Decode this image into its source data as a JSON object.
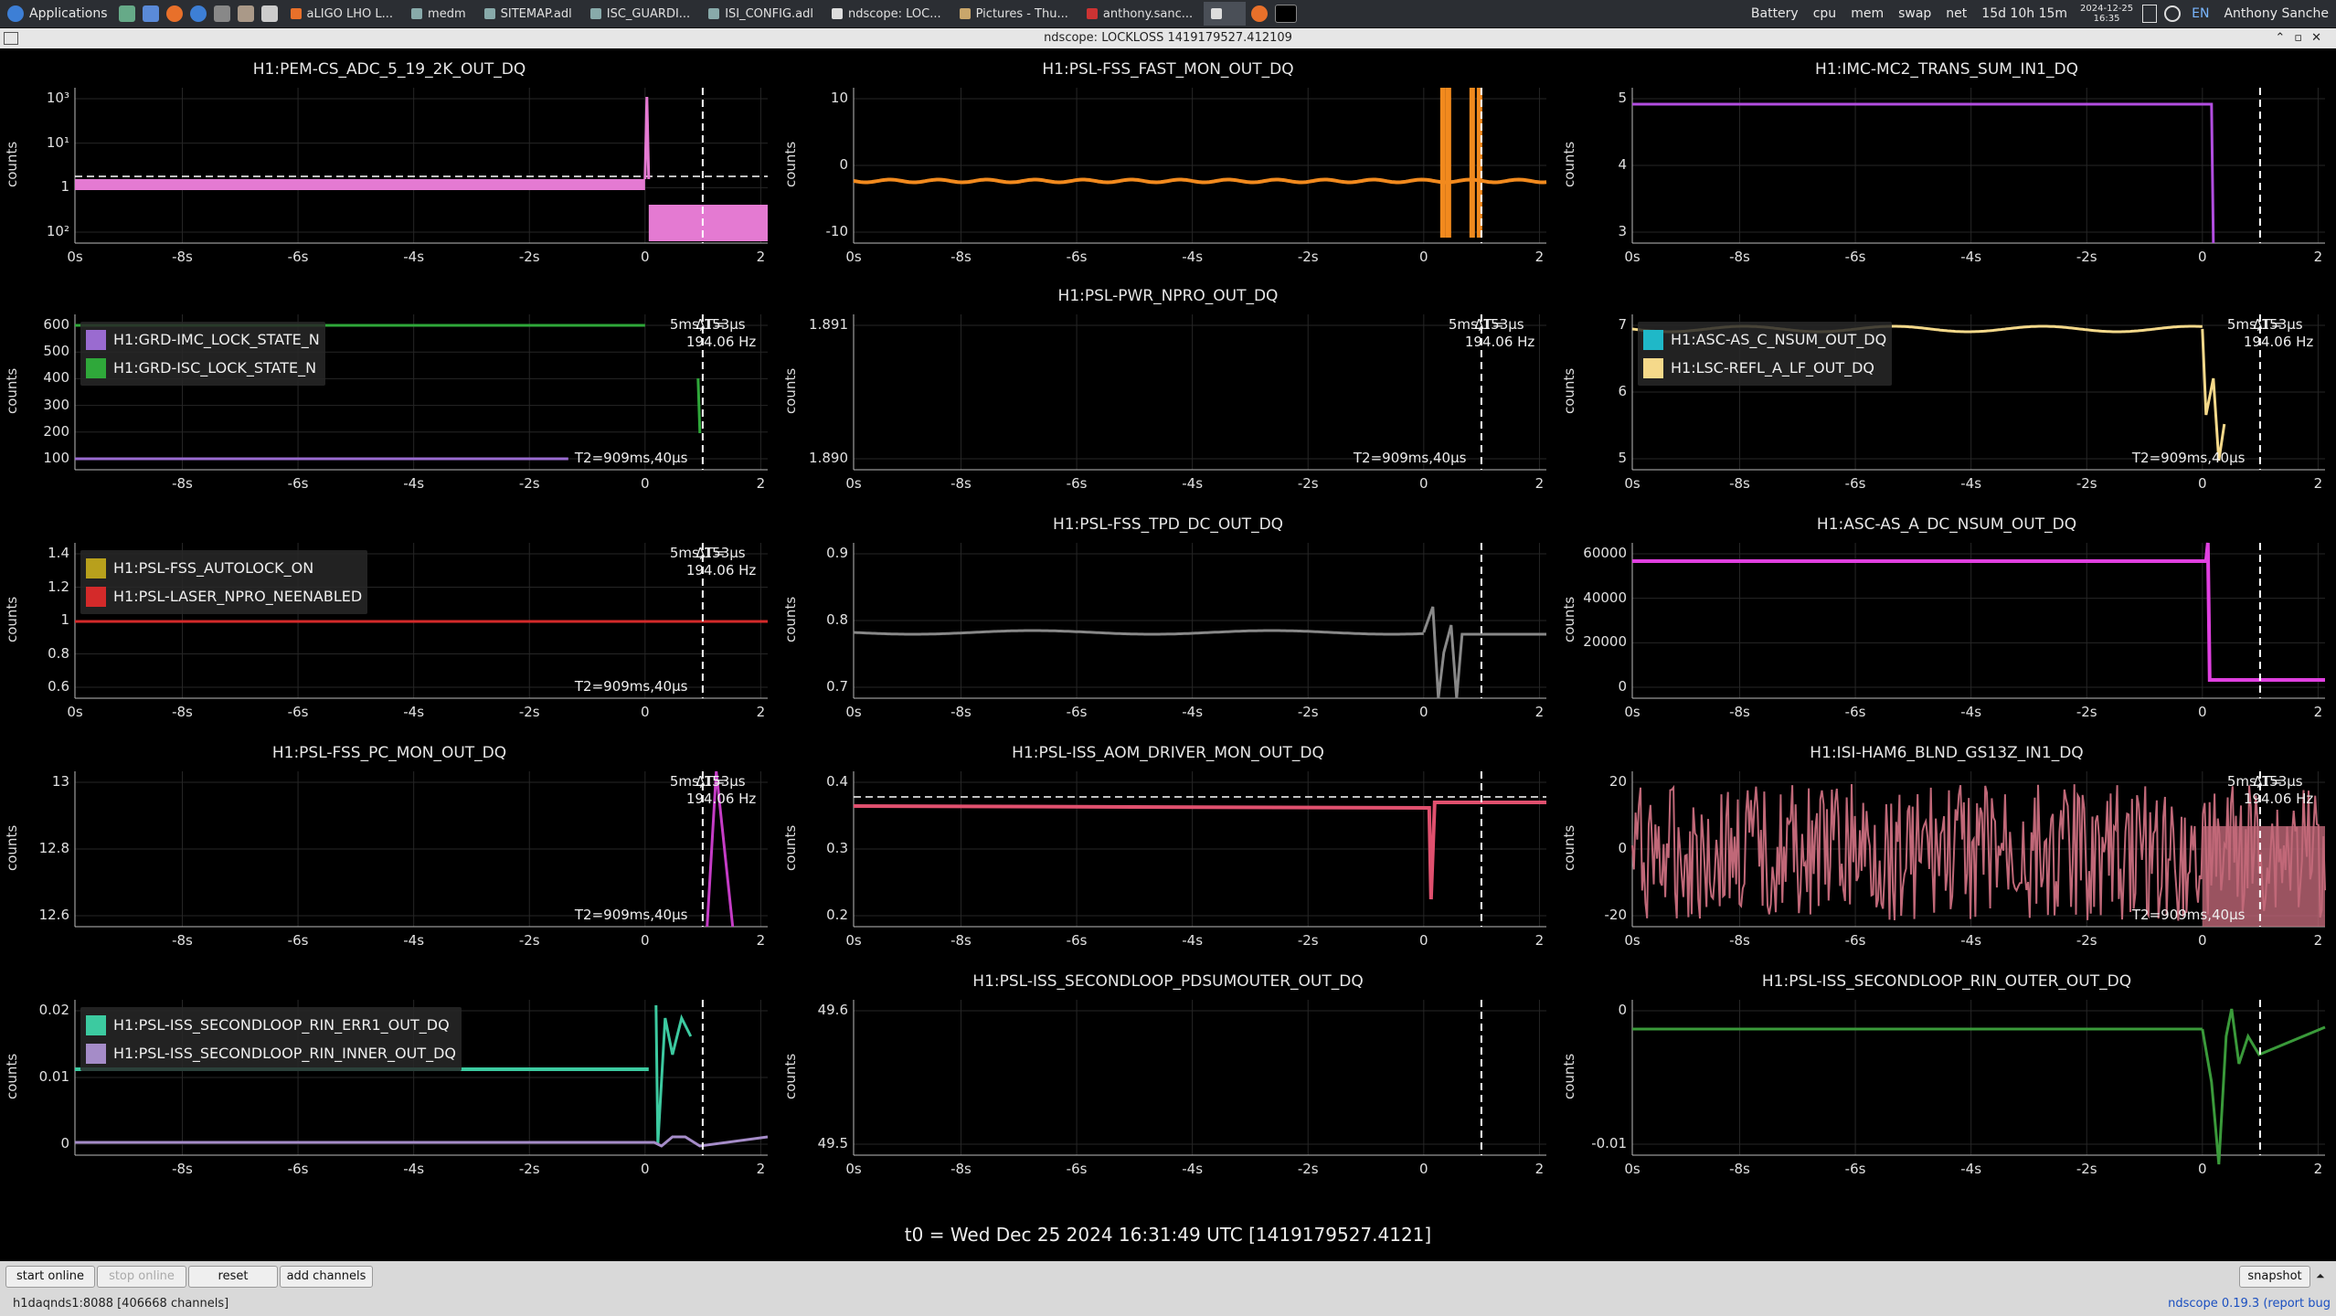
{
  "taskbar": {
    "applications_label": "Applications",
    "tasks": [
      {
        "label": "aLIGO LHO L..."
      },
      {
        "label": "medm"
      },
      {
        "label": "SITEMAP.adl"
      },
      {
        "label": "ISC_GUARDI..."
      },
      {
        "label": "ISI_CONFIG.adl"
      },
      {
        "label": "ndscope: LOC..."
      },
      {
        "label": "Pictures - Thu..."
      },
      {
        "label": "anthony.sanc..."
      }
    ],
    "status_items": [
      "Battery",
      "cpu",
      "mem",
      "swap",
      "net"
    ],
    "uptime": "15d 10h 15m",
    "date": "2024-12-25",
    "time": "16:35",
    "lang": "EN",
    "user": "Anthony Sanche"
  },
  "window": {
    "title": "ndscope: LOCKLOSS 1419179527.412109"
  },
  "plots": [
    {
      "title": "H1:PEM-CS_ADC_5_19_2K_OUT_DQ",
      "ylabel": "counts",
      "yticks": [
        "10³",
        "10¹",
        "1",
        "10²"
      ],
      "xticks": [
        "0s",
        "-8s",
        "-6s",
        "-4s",
        "-2s",
        "0",
        "2"
      ],
      "color": "#e47ad2"
    },
    {
      "title": "H1:PSL-FSS_FAST_MON_OUT_DQ",
      "ylabel": "counts",
      "yticks": [
        "10",
        "0",
        "-10"
      ],
      "xticks": [
        "0s",
        "-8s",
        "-6s",
        "-4s",
        "-2s",
        "0",
        "2"
      ],
      "color": "#f28a1e"
    },
    {
      "title": "H1:IMC-MC2_TRANS_SUM_IN1_DQ",
      "ylabel": "counts",
      "yticks": [
        "5",
        "4",
        "3"
      ],
      "xticks": [
        "0s",
        "-8s",
        "-6s",
        "-4s",
        "-2s",
        "0",
        "2"
      ],
      "color": "#b24de0"
    },
    {
      "title": "",
      "ylabel": "counts",
      "yticks": [
        "600",
        "500",
        "400",
        "300",
        "200",
        "100"
      ],
      "xticks": [
        "-8s",
        "-6s",
        "-4s",
        "-2s",
        "0",
        "2"
      ],
      "legend": [
        {
          "label": "H1:GRD-IMC_LOCK_STATE_N",
          "color": "#9a6bd0"
        },
        {
          "label": "H1:GRD-ISC_LOCK_STATE_N",
          "color": "#2fa83a"
        }
      ],
      "cursor_dt": "5ms,153μs",
      "cursor_freq": "194.06 Hz",
      "t2": "T2=909ms,40μs"
    },
    {
      "title": "H1:PSL-PWR_NPRO_OUT_DQ",
      "ylabel": "counts",
      "yticks": [
        "1.891",
        "1.890"
      ],
      "xticks": [
        "0s",
        "-8s",
        "-6s",
        "-4s",
        "-2s",
        "0",
        "2"
      ],
      "cursor_dt": "5ms,153μs",
      "cursor_freq": "194.06 Hz",
      "t2": "T2=909ms,40μs"
    },
    {
      "title": "",
      "ylabel": "counts",
      "yticks": [
        "7",
        "6",
        "5"
      ],
      "xticks": [
        "0s",
        "-8s",
        "-6s",
        "-4s",
        "-2s",
        "0",
        "2"
      ],
      "legend": [
        {
          "label": "H1:ASC-AS_C_NSUM_OUT_DQ",
          "color": "#1fb8c8"
        },
        {
          "label": "H1:LSC-REFL_A_LF_OUT_DQ",
          "color": "#f5d98a"
        }
      ],
      "cursor_dt": "5ms,153μs",
      "cursor_freq": "194.06 Hz",
      "t2": "T2=909ms,40μs"
    },
    {
      "title": "",
      "ylabel": "counts",
      "yticks": [
        "1.4",
        "1.2",
        "1",
        "0.8",
        "0.6"
      ],
      "xticks": [
        "0s",
        "-8s",
        "-6s",
        "-4s",
        "-2s",
        "0",
        "2"
      ],
      "legend": [
        {
          "label": "H1:PSL-FSS_AUTOLOCK_ON",
          "color": "#b8a01c"
        },
        {
          "label": "H1:PSL-LASER_NPRO_NEENABLED",
          "color": "#d42a2a"
        }
      ],
      "cursor_dt": "5ms,153μs",
      "cursor_freq": "194.06 Hz",
      "t2": "T2=909ms,40μs"
    },
    {
      "title": "H1:PSL-FSS_TPD_DC_OUT_DQ",
      "ylabel": "counts",
      "yticks": [
        "0.9",
        "0.8",
        "0.7"
      ],
      "xticks": [
        "0s",
        "-8s",
        "-6s",
        "-4s",
        "-2s",
        "0",
        "2"
      ],
      "color": "#888888"
    },
    {
      "title": "H1:ASC-AS_A_DC_NSUM_OUT_DQ",
      "ylabel": "counts",
      "yticks": [
        "60000",
        "40000",
        "20000",
        "0"
      ],
      "xticks": [
        "0s",
        "-8s",
        "-6s",
        "-4s",
        "-2s",
        "0",
        "2"
      ],
      "color": "#e040e0"
    },
    {
      "title": "H1:PSL-FSS_PC_MON_OUT_DQ",
      "ylabel": "counts",
      "yticks": [
        "13",
        "12.8",
        "12.6"
      ],
      "xticks": [
        "-8s",
        "-6s",
        "-4s",
        "-2s",
        "0",
        "2"
      ],
      "color": "#c53cc6",
      "cursor_dt": "5ms,153μs",
      "cursor_freq": "194.06 Hz",
      "t2": "T2=909ms,40μs"
    },
    {
      "title": "H1:PSL-ISS_AOM_DRIVER_MON_OUT_DQ",
      "ylabel": "counts",
      "yticks": [
        "0.4",
        "0.3",
        "0.2"
      ],
      "xticks": [
        "0s",
        "-8s",
        "-6s",
        "-4s",
        "-2s",
        "0",
        "2"
      ],
      "color": "#e0506e"
    },
    {
      "title": "H1:ISI-HAM6_BLND_GS13Z_IN1_DQ",
      "ylabel": "counts",
      "yticks": [
        "20",
        "0",
        "-20"
      ],
      "xticks": [
        "0s",
        "-8s",
        "-6s",
        "-4s",
        "-2s",
        "0",
        "2"
      ],
      "color": "#c06878",
      "cursor_dt": "5ms,153μs",
      "cursor_freq": "194.06 Hz",
      "t2": "T2=909ms,40μs"
    },
    {
      "title": "",
      "ylabel": "counts",
      "yticks": [
        "0.02",
        "0.01",
        "0"
      ],
      "xticks": [
        "-8s",
        "-6s",
        "-4s",
        "-2s",
        "0",
        "2"
      ],
      "legend": [
        {
          "label": "H1:PSL-ISS_SECONDLOOP_RIN_ERR1_OUT_DQ",
          "color": "#3ccaa0"
        },
        {
          "label": "H1:PSL-ISS_SECONDLOOP_RIN_INNER_OUT_DQ",
          "color": "#a58cc8"
        }
      ]
    },
    {
      "title": "H1:PSL-ISS_SECONDLOOP_PDSUMOUTER_OUT_DQ",
      "ylabel": "counts",
      "yticks": [
        "49.6",
        "49.5"
      ],
      "xticks": [
        "0s",
        "-8s",
        "-6s",
        "-4s",
        "-2s",
        "0",
        "2"
      ]
    },
    {
      "title": "H1:PSL-ISS_SECONDLOOP_RIN_OUTER_OUT_DQ",
      "ylabel": "counts",
      "yticks": [
        "0",
        "-0.01"
      ],
      "xticks": [
        "0s",
        "-8s",
        "-6s",
        "-4s",
        "-2s",
        "0",
        "2"
      ],
      "color": "#3a9a3a"
    }
  ],
  "t0_label": "t0 = Wed Dec 25 2024 16:31:49 UTC [1419179527.4121]",
  "buttons": {
    "start_online": "start online",
    "stop_online": "stop online",
    "reset": "reset",
    "add_channels": "add channels",
    "snapshot": "snapshot"
  },
  "status": {
    "server": "h1daqnds1:8088  [406668 channels]",
    "version": "ndscope 0.19.3 (report bug"
  }
}
